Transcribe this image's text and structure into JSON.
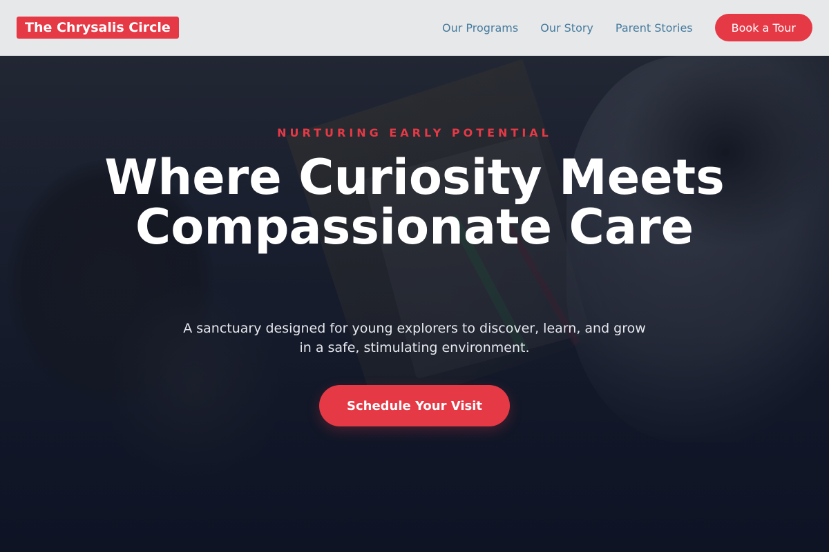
{
  "header": {
    "logo": "The Chrysalis Circle",
    "nav": [
      {
        "label": "Our Programs"
      },
      {
        "label": "Our Story"
      },
      {
        "label": "Parent Stories"
      }
    ],
    "cta_label": "Book a Tour"
  },
  "hero": {
    "eyebrow": "NURTURING EARLY POTENTIAL",
    "headline": "Where Curiosity Meets Compassionate Care",
    "subtitle": "A sanctuary designed for young explorers to discover, learn, and grow in a safe, stimulating environment.",
    "cta_label": "Schedule Your Visit"
  },
  "colors": {
    "accent": "#e63946",
    "nav_link": "#457b9d",
    "header_bg": "#e7e8ea",
    "hero_bg": "#121a2b"
  }
}
